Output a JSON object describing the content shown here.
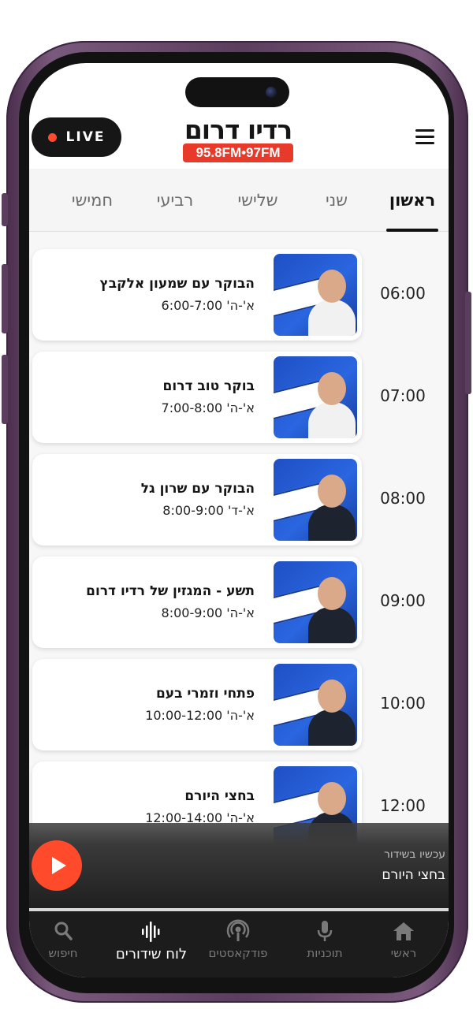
{
  "header": {
    "live_label": "LIVE",
    "logo_name": "רדיו דרום",
    "logo_freq": "95.8FM•97FM"
  },
  "tabs": [
    {
      "label": "ראשון",
      "active": true
    },
    {
      "label": "שני",
      "active": false
    },
    {
      "label": "שלישי",
      "active": false
    },
    {
      "label": "רביעי",
      "active": false
    },
    {
      "label": "חמישי",
      "active": false
    }
  ],
  "schedule": [
    {
      "time": "06:00",
      "title": "הבוקר עם שמעון אלקבץ",
      "days": "א'-ה' 6:00-7:00",
      "thumb": "show-thumbnail"
    },
    {
      "time": "07:00",
      "title": "בוקר טוב דרום",
      "days": "א'-ה' 7:00-8:00",
      "thumb": "show-thumbnail"
    },
    {
      "time": "08:00",
      "title": "הבוקר עם שרון גל",
      "days": "א'-ד' 8:00-9:00",
      "thumb": "show-thumbnail"
    },
    {
      "time": "09:00",
      "title": "תשע - המגזין של רדיו דרום",
      "days": "א'-ה' 8:00-9:00",
      "thumb": "show-thumbnail"
    },
    {
      "time": "10:00",
      "title": "פתחי וזמרי בעם",
      "days": "א'-ה' 10:00-12:00",
      "thumb": "show-thumbnail"
    },
    {
      "time": "12:00",
      "title": "בחצי היורם",
      "days": "א'-ה' 12:00-14:00",
      "thumb": "show-thumbnail"
    }
  ],
  "now_playing": {
    "label": "עכשיו בשידור",
    "title": "בחצי היורם"
  },
  "bottom_nav": [
    {
      "label": "ראשי",
      "icon": "home-icon",
      "active": false
    },
    {
      "label": "תוכניות",
      "icon": "microphone-icon",
      "active": false
    },
    {
      "label": "פודקאסטים",
      "icon": "podcast-icon",
      "active": false
    },
    {
      "label": "לוח שידורים",
      "icon": "waveform-icon",
      "active": true
    },
    {
      "label": "חיפוש",
      "icon": "search-icon",
      "active": false
    }
  ],
  "colors": {
    "accent": "#ff4b2b",
    "logo_red": "#e83a2a",
    "thumb_blue": "#2a66e0",
    "nav_bg": "#1c1c1c"
  }
}
